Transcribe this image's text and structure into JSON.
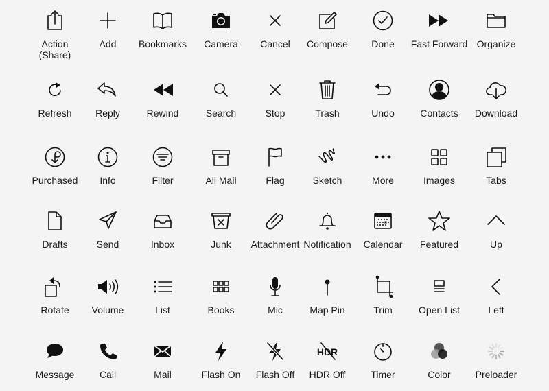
{
  "page": {
    "background": "#f4f4f4",
    "icon_color": "#111111"
  },
  "rows": [
    {
      "items": [
        {
          "label": "Action\n(Share)",
          "icon": "share-icon"
        },
        {
          "label": "Add",
          "icon": "plus-icon"
        },
        {
          "label": "Bookmarks",
          "icon": "book-icon"
        },
        {
          "label": "Camera",
          "icon": "camera-icon"
        },
        {
          "label": "Cancel",
          "icon": "x-icon"
        },
        {
          "label": "Compose",
          "icon": "compose-icon"
        },
        {
          "label": "Done",
          "icon": "checkmark-circle-icon"
        },
        {
          "label": "Fast Forward",
          "icon": "fast-forward-icon"
        },
        {
          "label": "Organize",
          "icon": "folder-icon"
        }
      ]
    },
    {
      "items": [
        {
          "label": "Refresh",
          "icon": "refresh-icon"
        },
        {
          "label": "Reply",
          "icon": "reply-arrow-icon"
        },
        {
          "label": "Rewind",
          "icon": "rewind-icon"
        },
        {
          "label": "Search",
          "icon": "magnifier-icon"
        },
        {
          "label": "Stop",
          "icon": "x-icon"
        },
        {
          "label": "Trash",
          "icon": "trash-icon"
        },
        {
          "label": "Undo",
          "icon": "undo-arrow-icon"
        },
        {
          "label": "Contacts",
          "icon": "person-circle-icon"
        },
        {
          "label": "Download",
          "icon": "cloud-download-icon"
        }
      ]
    },
    {
      "items": [
        {
          "label": "Purchased",
          "icon": "purchased-circle-icon"
        },
        {
          "label": "Info",
          "icon": "info-circle-icon"
        },
        {
          "label": "Filter",
          "icon": "filter-circle-icon"
        },
        {
          "label": "All Mail",
          "icon": "archive-box-icon"
        },
        {
          "label": "Flag",
          "icon": "flag-icon"
        },
        {
          "label": "Sketch",
          "icon": "squiggle-icon"
        },
        {
          "label": "More",
          "icon": "ellipsis-icon"
        },
        {
          "label": "Images",
          "icon": "grid-2x2-icon"
        },
        {
          "label": "Tabs",
          "icon": "stacked-squares-icon"
        }
      ]
    },
    {
      "items": [
        {
          "label": "Drafts",
          "icon": "document-icon"
        },
        {
          "label": "Send",
          "icon": "paper-plane-icon"
        },
        {
          "label": "Inbox",
          "icon": "tray-icon"
        },
        {
          "label": "Junk",
          "icon": "junk-bin-icon"
        },
        {
          "label": "Attachment",
          "icon": "paperclip-icon"
        },
        {
          "label": "Notification",
          "icon": "bell-icon"
        },
        {
          "label": "Calendar",
          "icon": "calendar-icon"
        },
        {
          "label": "Featured",
          "icon": "star-icon"
        },
        {
          "label": "Up",
          "icon": "chevron-up-icon"
        }
      ]
    },
    {
      "items": [
        {
          "label": "Rotate",
          "icon": "rotate-icon"
        },
        {
          "label": "Volume",
          "icon": "speaker-icon"
        },
        {
          "label": "List",
          "icon": "list-icon"
        },
        {
          "label": "Books",
          "icon": "grid-3x2-icon"
        },
        {
          "label": "Mic",
          "icon": "microphone-icon"
        },
        {
          "label": "Map Pin",
          "icon": "map-pin-icon"
        },
        {
          "label": "Trim",
          "icon": "crop-icon"
        },
        {
          "label": "Open List",
          "icon": "open-list-icon"
        },
        {
          "label": "Left",
          "icon": "chevron-left-icon"
        }
      ]
    },
    {
      "items": [
        {
          "label": "Message",
          "icon": "speech-bubble-icon"
        },
        {
          "label": "Call",
          "icon": "phone-icon"
        },
        {
          "label": "Mail",
          "icon": "envelope-icon"
        },
        {
          "label": "Flash On",
          "icon": "lightning-icon"
        },
        {
          "label": "Flash Off",
          "icon": "lightning-slash-icon"
        },
        {
          "label": "HDR Off",
          "icon": "hdr-slash-icon",
          "glyph_text": "HDR"
        },
        {
          "label": "Timer",
          "icon": "timer-icon"
        },
        {
          "label": "Color",
          "icon": "color-circles-icon"
        },
        {
          "label": "Preloader",
          "icon": "spinner-icon"
        }
      ]
    }
  ]
}
